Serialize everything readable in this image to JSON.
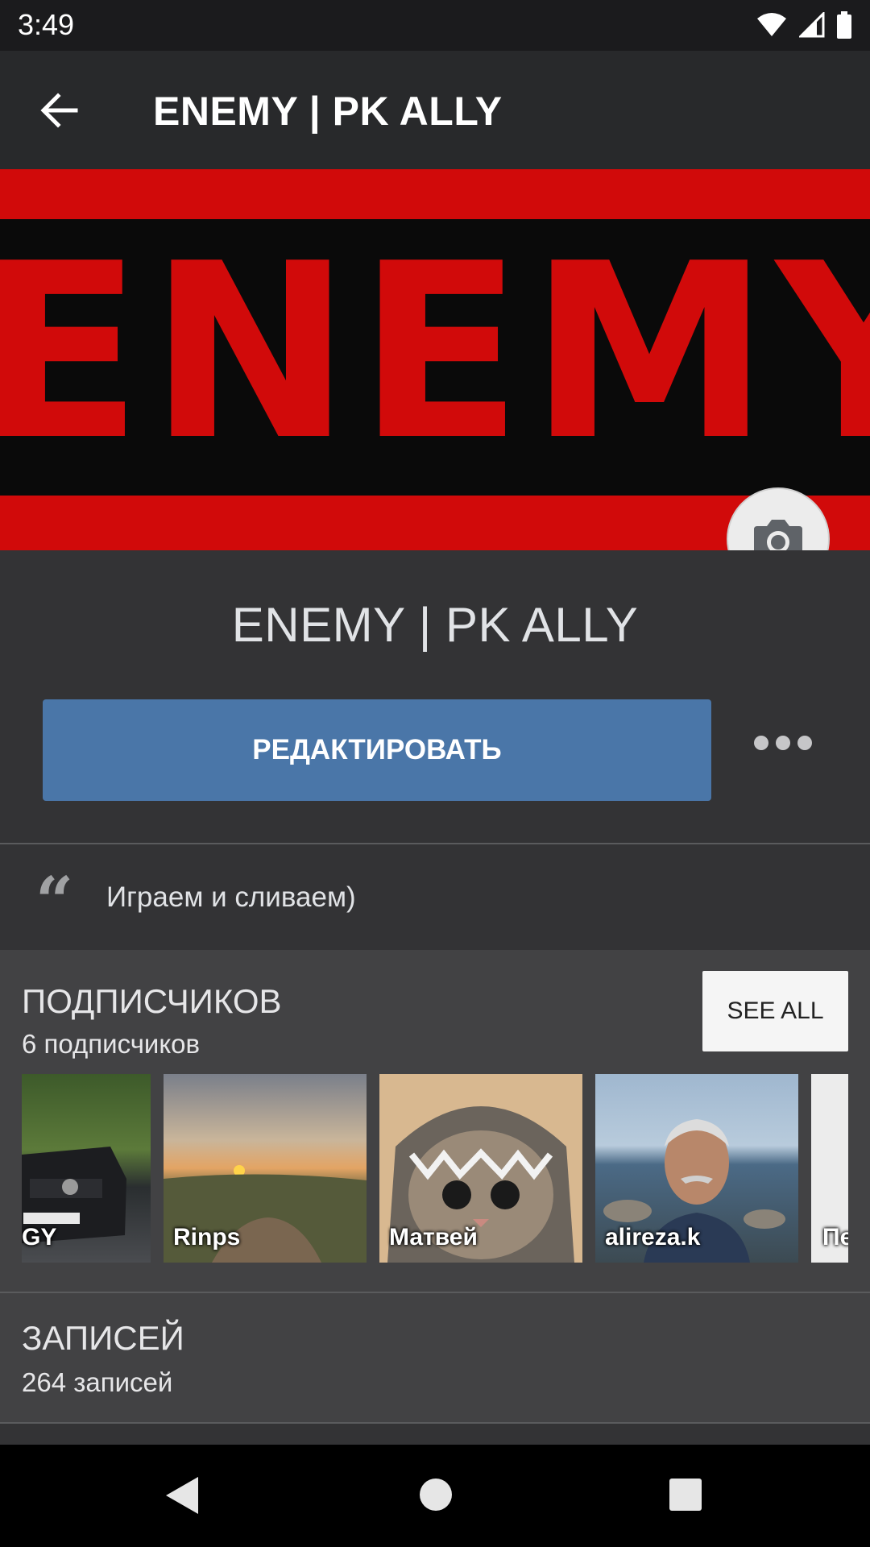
{
  "status_bar": {
    "time": "3:49"
  },
  "toolbar": {
    "title": "ENEMY | PK ALLY"
  },
  "cover": {
    "text": "ENEMY"
  },
  "profile": {
    "name": "ENEMY | PK ALLY",
    "edit_label": "РЕДАКТИРОВАТЬ"
  },
  "status": {
    "quote_mark": "“",
    "text": "Играем и сливаем)"
  },
  "followers": {
    "title": "ПОДПИСЧИКОВ",
    "count_text": "6 подписчиков",
    "see_all_label": "SEE ALL",
    "items": [
      {
        "name": "GY"
      },
      {
        "name": "Rinps"
      },
      {
        "name": "Матвей"
      },
      {
        "name": "alireza.k"
      },
      {
        "name": "Пе"
      }
    ]
  },
  "posts": {
    "title": "ЗАПИСЕЙ",
    "count_text": "264 записей"
  },
  "colors": {
    "accent": "#4a76a8",
    "cover_red": "#d10a0a",
    "background": "#333335"
  }
}
